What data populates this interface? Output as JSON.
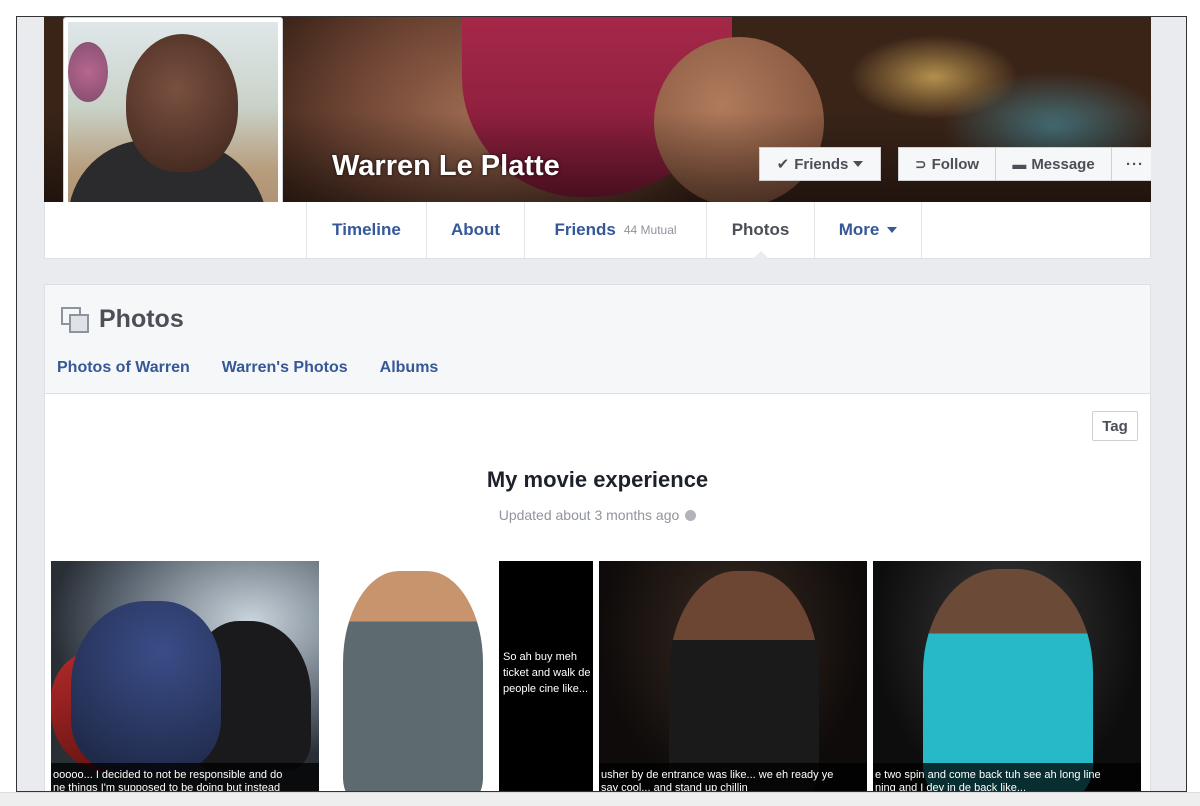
{
  "profile": {
    "name": "Warren Le Platte"
  },
  "cover_actions": {
    "friends_label": "Friends",
    "follow_label": "Follow",
    "message_label": "Message",
    "more_label": "···"
  },
  "nav": {
    "tabs": [
      {
        "label": "Timeline"
      },
      {
        "label": "About"
      },
      {
        "label": "Friends",
        "meta": "44 Mutual"
      },
      {
        "label": "Photos"
      },
      {
        "label": "More"
      }
    ],
    "active_tab": "Photos"
  },
  "photos_panel": {
    "title": "Photos",
    "subtabs": [
      "Photos of Warren",
      "Warren's Photos",
      "Albums"
    ],
    "tag_label": "Tag"
  },
  "album": {
    "title": "My movie experience",
    "updated": "Updated about 3 months ago",
    "photos": [
      {
        "caption_line1": "ooooo... I decided to not be responsible and do",
        "caption_line2": "ne things I'm supposed to be doing but instead"
      },
      {
        "side_text": "So ah buy meh ticket and walk de people cine like..."
      },
      {
        "caption_line1": "usher by de entrance was like... we eh ready ye",
        "caption_line2": "say cool... and stand up chillin"
      },
      {
        "caption_line1": "e two spin and come back tuh see ah long line",
        "caption_line2": "ning and I dey in de back like..."
      }
    ]
  },
  "colors": {
    "link": "#365899",
    "background": "#e9ebee",
    "text_dark": "#1d2129",
    "muted": "#90949c"
  }
}
